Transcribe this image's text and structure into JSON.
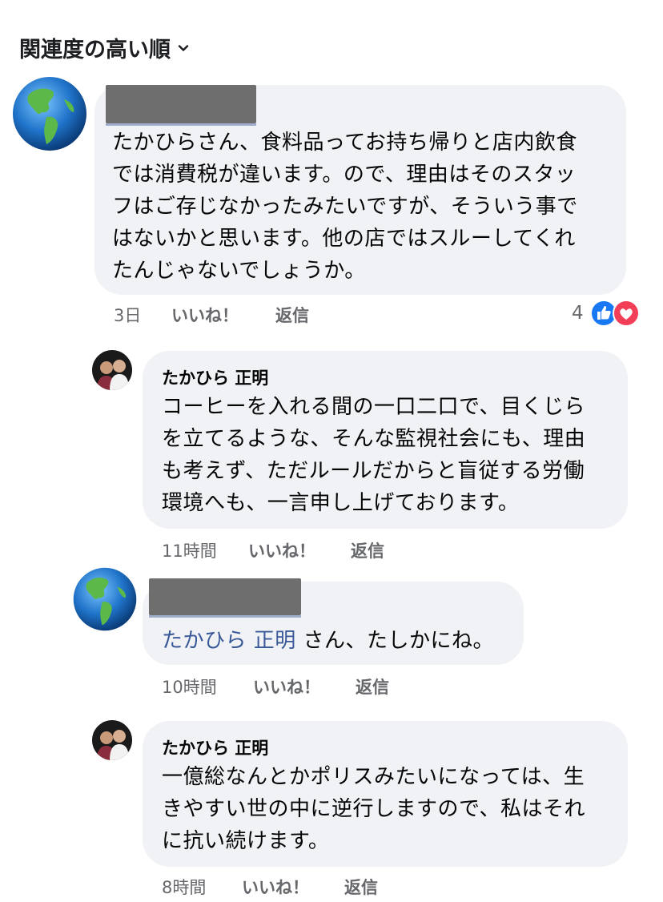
{
  "sort": {
    "label": "関連度の高い順"
  },
  "comments": [
    {
      "author": "",
      "text_lines": [
        "たかひらさん、食料品ってお持ち帰りと店内飲食",
        "では消費税が違います。ので、理由はそのスタッ",
        "フはご存じなかったみたいですが、そういう事で",
        "はないかと思います。他の店ではスルーしてくれ",
        "たんじゃないでしょうか。"
      ],
      "time": "3日",
      "like_label": "いいね！",
      "reply_label": "返信",
      "reaction_count": "4",
      "reactions": [
        "like-icon",
        "love-icon"
      ]
    },
    {
      "author": "たかひら 正明",
      "text_lines": [
        "コーヒーを入れる間の一口二口で、目くじら",
        "を立てるような、そんな監視社会にも、理由",
        "も考えず、ただルールだからと盲従する労働",
        "環境へも、一言申し上げております。"
      ],
      "time": "11時間",
      "like_label": "いいね！",
      "reply_label": "返信"
    },
    {
      "author": "",
      "mention": "たかひら 正明",
      "text": " さん、たしかにね。",
      "time": "10時間",
      "like_label": "いいね！",
      "reply_label": "返信"
    },
    {
      "author": "たかひら 正明",
      "text_lines": [
        "一億総なんとかポリスみたいになっては、生",
        "きやすい世の中に逆行しますので、私はそれ",
        "に抗い続けます。"
      ],
      "time": "8時間",
      "like_label": "いいね！",
      "reply_label": "返信"
    }
  ],
  "colors": {
    "bubble": "#f0f2f5",
    "meta_text": "#65676b",
    "mention": "#385898",
    "like_blue": "#1877f2",
    "love_red": "#f33e58"
  }
}
